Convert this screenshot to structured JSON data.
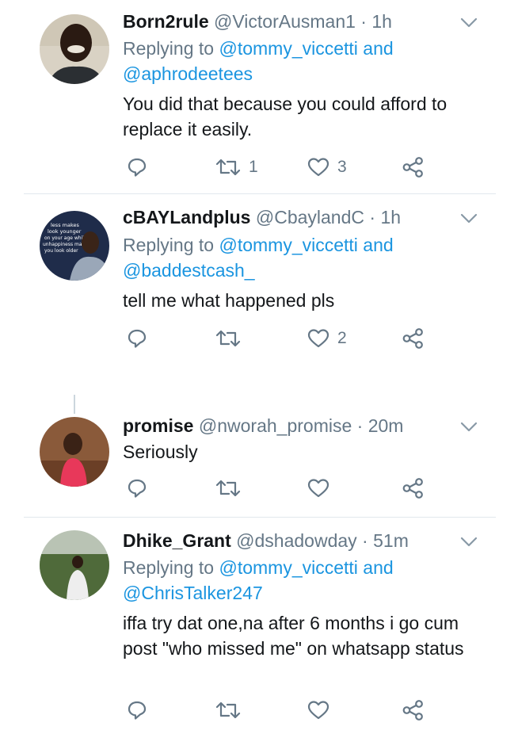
{
  "tweets": [
    {
      "name": "Born2rule",
      "handle": "@VictorAusman1",
      "dot": " · ",
      "time": "1h",
      "replying_prefix": "Replying to ",
      "replying_user1": "@tommy_viccetti",
      "replying_and": " and",
      "replying_user2": "@aphrodeetees",
      "text": "You did that because you could afford to replace it easily.",
      "retweets": "1",
      "likes": "3"
    },
    {
      "name": "cBAYLandplus",
      "handle": "@CbaylandC",
      "dot": " · ",
      "time": "1h",
      "replying_prefix": "Replying to ",
      "replying_user1": "@tommy_viccetti",
      "replying_and": " and",
      "replying_user2": "@baddestcash_",
      "text": "tell me what happened pls",
      "retweets": "",
      "likes": "2",
      "avatar_text": [
        "less makes",
        "look younger",
        "on your age while",
        "unhappiness makes",
        "you look older"
      ]
    },
    {
      "name": "promise",
      "handle": "@nworah_promise",
      "dot": " · ",
      "time": "20m",
      "text": "Seriously",
      "retweets": "",
      "likes": ""
    },
    {
      "name": "Dhike_Grant",
      "handle": "@dshadowday",
      "dot": " · ",
      "time": "51m",
      "replying_prefix": "Replying to ",
      "replying_user1": "@tommy_viccetti",
      "replying_and": " and",
      "replying_user2": "@ChrisTalker247",
      "text": "iffa try dat one,na after 6 months i go cum post \"who missed me\" on whatsapp status",
      "retweets": "",
      "likes": ""
    }
  ],
  "icons": {
    "reply": "reply-icon",
    "retweet": "retweet-icon",
    "like": "heart-icon",
    "share": "share-icon",
    "caret": "chevron-down-icon"
  },
  "colors": {
    "text": "#14171a",
    "secondary": "#657786",
    "link": "#1b95e0",
    "divider": "#e1e8ed"
  }
}
